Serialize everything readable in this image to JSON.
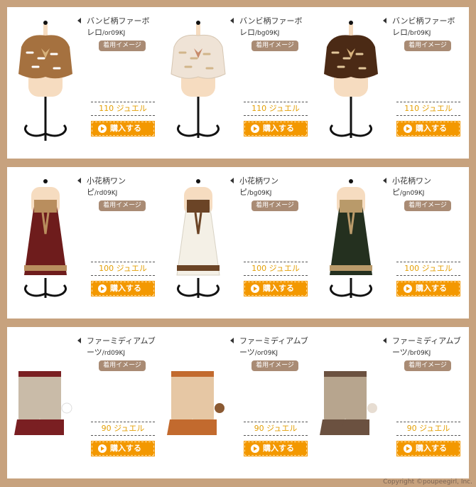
{
  "rows": [
    {
      "kind": "cape",
      "items": [
        {
          "name": "バンビ柄ファーボレロ",
          "code": "/or09KJ",
          "badge": "着用イメージ",
          "price": "110 ジュエル",
          "buy": "購入する",
          "color": "#a5713f",
          "accent": "#ffffff"
        },
        {
          "name": "バンビ柄ファーボレロ",
          "code": "/bg09KJ",
          "badge": "着用イメージ",
          "price": "110 ジュエル",
          "buy": "購入する",
          "color": "#efe3d6",
          "accent": "#d1b58a"
        },
        {
          "name": "バンビ柄ファーボレロ",
          "code": "/br09KJ",
          "badge": "着用イメージ",
          "price": "110 ジュエル",
          "buy": "購入する",
          "color": "#4b2a15",
          "accent": "#e2c79a"
        }
      ]
    },
    {
      "kind": "dress",
      "items": [
        {
          "name": "小花柄ワンピ",
          "code": "/rd09KJ",
          "badge": "着用イメージ",
          "price": "100 ジュエル",
          "buy": "購入する",
          "color": "#6e1c1c",
          "accent": "#b98e5e"
        },
        {
          "name": "小花柄ワンピ",
          "code": "/bg09KJ",
          "badge": "着用イメージ",
          "price": "100 ジュエル",
          "buy": "購入する",
          "color": "#f4f0e6",
          "accent": "#6b4426"
        },
        {
          "name": "小花柄ワンピ",
          "code": "/gn09KJ",
          "badge": "着用イメージ",
          "price": "100 ジュエル",
          "buy": "購入する",
          "color": "#24301f",
          "accent": "#b99a6a"
        }
      ]
    },
    {
      "kind": "boots",
      "items": [
        {
          "name": "ファーミディアムブーツ",
          "code": "/rd09KJ",
          "badge": "着用イメージ",
          "price": "90 ジュエル",
          "buy": "購入する",
          "color": "#7a1f22",
          "accent": "#c9bba8"
        },
        {
          "name": "ファーミディアムブーツ",
          "code": "/or09KJ",
          "badge": "着用イメージ",
          "price": "90 ジュエル",
          "buy": "購入する",
          "color": "#c26a2e",
          "accent": "#e6c7a4"
        },
        {
          "name": "ファーミディアムブーツ",
          "code": "/br09KJ",
          "badge": "着用イメージ",
          "price": "90 ジュエル",
          "buy": "購入する",
          "color": "#6b5140",
          "accent": "#b7a58e"
        }
      ]
    }
  ],
  "footer": {
    "copyright": "Copyright ©poupeegirl, Inc."
  }
}
